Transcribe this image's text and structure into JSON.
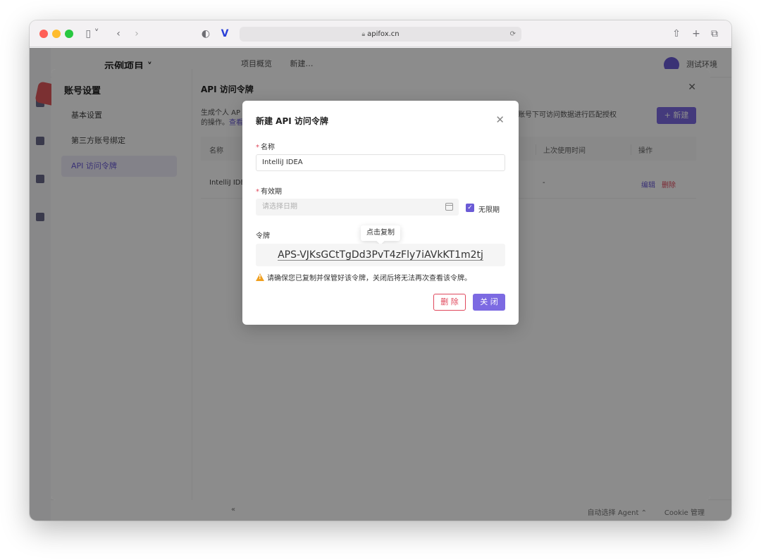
{
  "browser": {
    "url": "apifox.cn",
    "translate_icon": "㊗",
    "icons": [
      "sidebar-icon",
      "back-icon",
      "forward-icon",
      "shield-icon",
      "share-icon",
      "new-tab-icon",
      "tabs-icon"
    ]
  },
  "app": {
    "project_title": "示例项目 ˅",
    "tabs": [
      "项目概览",
      "新建…"
    ],
    "env": "测试环境",
    "footer": {
      "collapse": "«",
      "agent": "自动选择 Agent ⌃",
      "cookie": "Cookie 管理"
    }
  },
  "settings": {
    "title": "账号设置",
    "nav": [
      "基本设置",
      "第三方账号绑定",
      "API 访问令牌"
    ],
    "right_title": "API 访问令牌",
    "desc_line1": "生成个人 AP",
    "desc_line2_prefix": "的操作。",
    "desc_link": "查看",
    "desc_tail": "前账号下可访问数据进行匹配授权",
    "new_button": "+ 新建",
    "table": {
      "headers": [
        "名称",
        "上次使用时间",
        "操作"
      ],
      "row": {
        "name": "IntelliJ IDE",
        "last_used": "-",
        "edit": "编辑",
        "delete": "删除"
      }
    }
  },
  "dialog": {
    "title": "新建 API 访问令牌",
    "name_label": "名称",
    "name_value": "IntelliJ IDEA",
    "expiry_label": "有效期",
    "date_placeholder": "请选择日期",
    "unlimited_label": "无限期",
    "token_label": "令牌",
    "tooltip": "点击复制",
    "token_value": "APS-VJKsGCtTgDd3PvT4zFly7iAVkKT1m2tj",
    "warning": "请确保您已复制并保管好该令牌，关闭后将无法再次查看该令牌。",
    "delete_button": "删 除",
    "close_button": "关 闭"
  },
  "colors": {
    "accent": "#7c6ae2",
    "danger": "#e0485c",
    "warning": "#f0a020"
  }
}
